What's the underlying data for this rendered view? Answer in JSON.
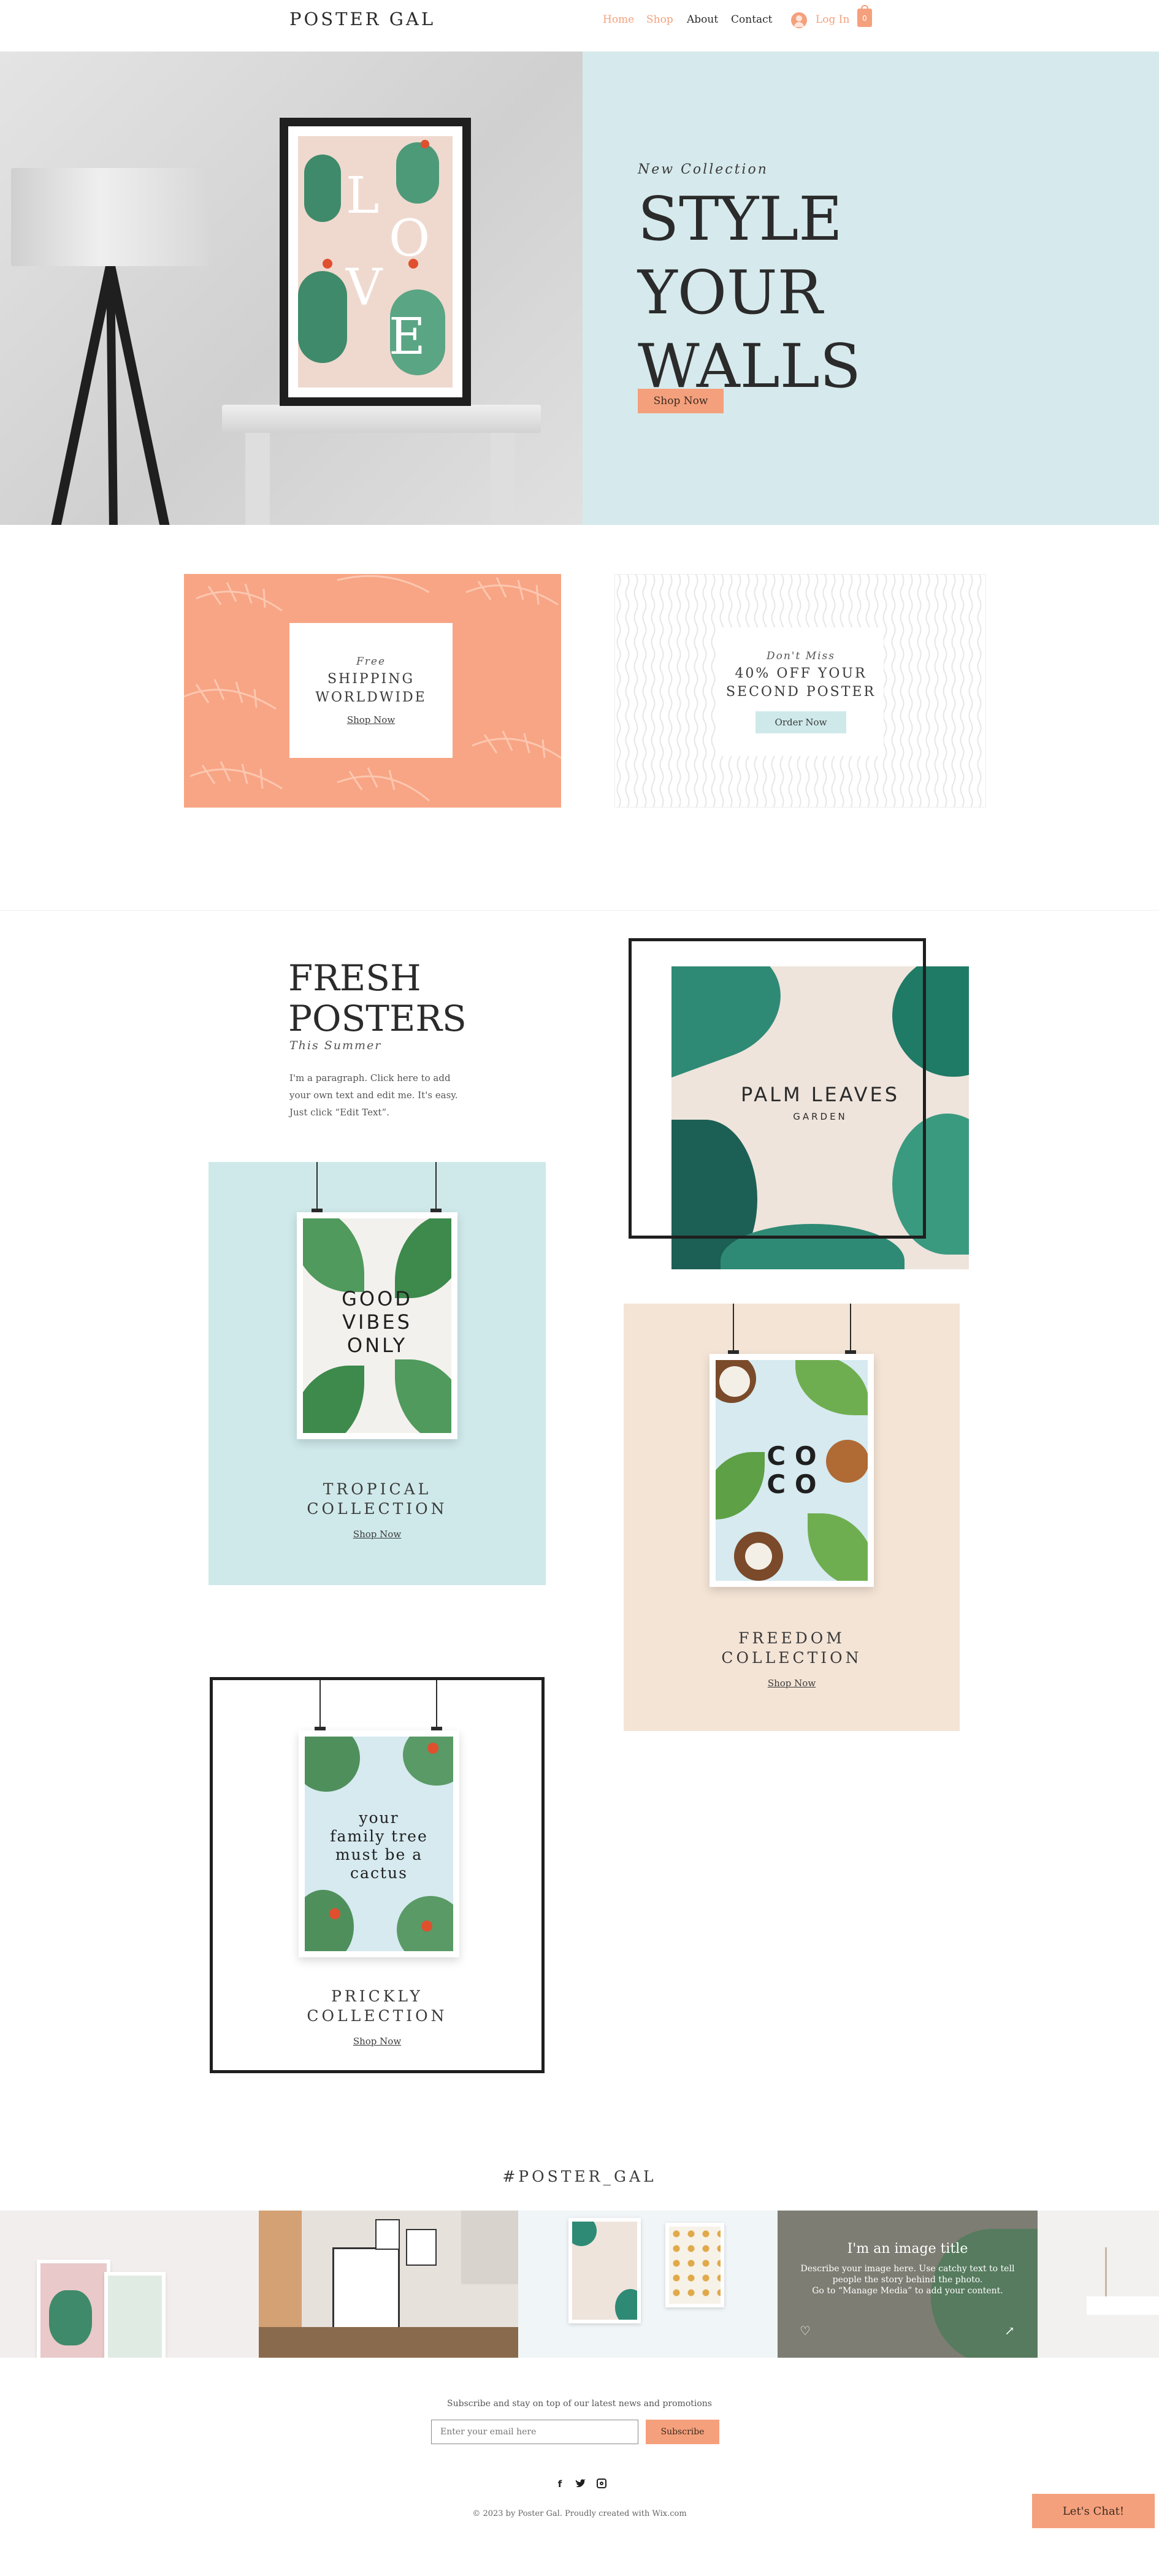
{
  "header": {
    "logo": "POSTER GAL",
    "nav": [
      "Home",
      "Shop",
      "About",
      "Contact"
    ],
    "login_label": "Log In",
    "cart_count": "0"
  },
  "hero": {
    "subtitle": "New Collection",
    "title_lines": [
      "STYLE",
      "YOUR",
      "WALLS"
    ],
    "button_label": "Shop Now",
    "poster_letters": [
      "L",
      "O",
      "V",
      "E"
    ]
  },
  "promos": {
    "left": {
      "kicker": "Free",
      "title_lines": [
        "SHIPPING",
        "WORLDWIDE"
      ],
      "link": "Shop Now"
    },
    "right": {
      "kicker": "Don't Miss",
      "title_lines": [
        "40% OFF YOUR",
        "SECOND POSTER"
      ],
      "button": "Order Now"
    }
  },
  "fresh": {
    "title_lines": [
      "FRESH",
      "POSTERS"
    ],
    "subtitle": "This Summer",
    "paragraph_lines": [
      "I'm a paragraph. Click here to add",
      "your own text and edit me. It's easy.",
      "Just click “Edit Text”."
    ]
  },
  "palm_poster": {
    "title": "PALM LEAVES",
    "subtitle": "GARDEN"
  },
  "collections": [
    {
      "poster_lines": [
        "GOOD",
        "VIBES",
        "ONLY"
      ],
      "label_lines": [
        "TROPICAL",
        "COLLECTION"
      ],
      "link": "Shop Now"
    },
    {
      "poster_lines": [
        "C O",
        "C O"
      ],
      "label_lines": [
        "FREEDOM",
        "COLLECTION"
      ],
      "link": "Shop Now"
    },
    {
      "poster_lines": [
        "your",
        "family tree",
        "must be a",
        "cactus"
      ],
      "label_lines": [
        "PRICKLY",
        "COLLECTION"
      ],
      "link": "Shop Now"
    }
  ],
  "instagram": {
    "handle": "#POSTER_GAL",
    "overlay_title": "I'm an image title",
    "overlay_lines": [
      "Describe your image here. Use catchy text to tell",
      "people the story behind the photo.",
      "Go to “Manage Media” to add your content."
    ]
  },
  "footer": {
    "subscribe_text": "Subscribe and stay on top of our latest news and promotions",
    "email_placeholder": "Enter your email here",
    "subscribe_button": "Subscribe",
    "copyright": "© 2023 by Poster Gal. Proudly created with Wix.com",
    "chat_button": "Let's Chat!"
  },
  "colors": {
    "accent": "#f5a07c",
    "mint": "#d6eaed",
    "peach": "#f4e4d6"
  },
  "icons": [
    "facebook-icon",
    "twitter-icon",
    "instagram-icon",
    "avatar-icon",
    "cart-icon",
    "heart-icon",
    "share-icon"
  ]
}
